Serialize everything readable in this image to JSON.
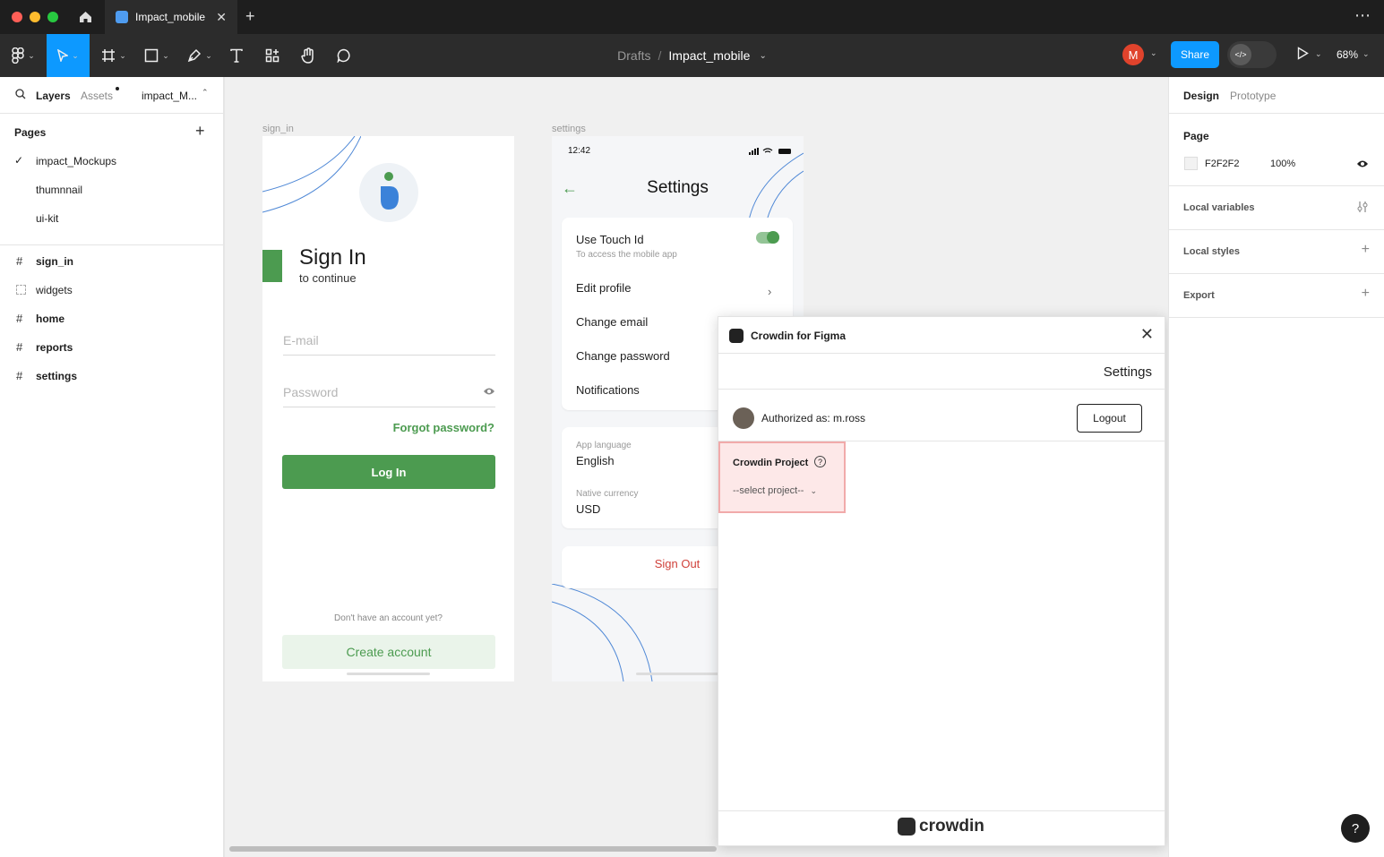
{
  "titlebar": {
    "tab_title": "Impact_mobile",
    "tab_close": "✕",
    "new_tab": "+",
    "more": "⋯"
  },
  "toolbar": {
    "breadcrumb_drafts": "Drafts",
    "breadcrumb_sep": "/",
    "breadcrumb_file": "Impact_mobile",
    "avatar_initial": "M",
    "share_label": "Share",
    "zoom": "68%"
  },
  "left_panel": {
    "tabs": [
      "Layers",
      "Assets",
      "impact_M..."
    ],
    "pages_heading": "Pages",
    "pages": [
      "impact_Mockups",
      "thumnnail",
      "ui-kit"
    ],
    "layers": [
      "sign_in",
      "widgets",
      "home",
      "reports",
      "settings"
    ]
  },
  "canvas": {
    "frame_labels": [
      "sign_in",
      "settings"
    ],
    "signin": {
      "title": "Sign In",
      "subtitle": "to continue",
      "email_placeholder": "E-mail",
      "password_placeholder": "Password",
      "forgot": "Forgot password?",
      "login": "Log In",
      "no_account": "Don't have an account yet?",
      "create": "Create account"
    },
    "settings": {
      "status_time": "12:42",
      "title": "Settings",
      "touch_id": "Use Touch Id",
      "touch_id_hint": "To access the mobile app",
      "rows": [
        "Edit profile",
        "Change email",
        "Change password",
        "Notifications"
      ],
      "app_language_label": "App language",
      "app_language": "English",
      "currency_label": "Native currency",
      "currency": "USD",
      "sign_out": "Sign Out"
    }
  },
  "plugin": {
    "title": "Crowdin for Figma",
    "section": "Settings",
    "authorized": "Authorized as: m.ross",
    "logout": "Logout",
    "project_label": "Crowdin Project",
    "project_placeholder": "--select project--",
    "brand": "crowdin"
  },
  "right_panel": {
    "tabs": [
      "Design",
      "Prototype"
    ],
    "page_heading": "Page",
    "page_color": "F2F2F2",
    "page_opacity": "100%",
    "sections": [
      "Local variables",
      "Local styles",
      "Export"
    ]
  },
  "colors": {
    "accent": "#0d99ff",
    "brand_green": "#4c9b50",
    "danger": "#d0413a"
  }
}
